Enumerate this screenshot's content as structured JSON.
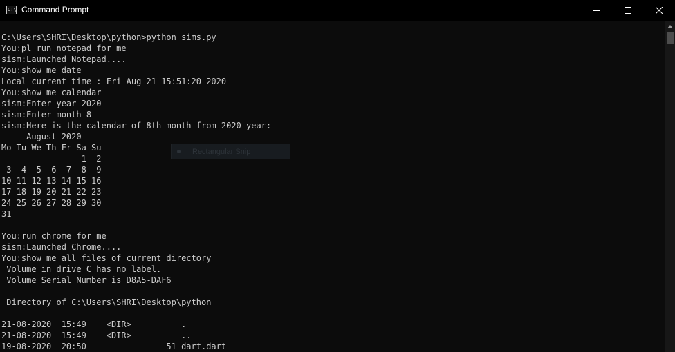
{
  "window": {
    "title": "Command Prompt",
    "icon": "command-prompt-icon",
    "icon_glyph": "C:\\.",
    "controls": [
      "minimize-icon",
      "maximize-icon",
      "close-icon"
    ]
  },
  "console": {
    "text_color": "#cccccc",
    "background": "#0c0c0c",
    "lines": [
      "C:\\Users\\SHRI\\Desktop\\python>python sims.py",
      "You:pl run notepad for me",
      "sism:Launched Notepad....",
      "You:show me date",
      "Local current time : Fri Aug 21 15:51:20 2020",
      "You:show me calendar",
      "sism:Enter year-2020",
      "sism:Enter month-8",
      "sism:Here is the calendar of 8th month from 2020 year:",
      "     August 2020",
      "Mo Tu We Th Fr Sa Su",
      "                1  2",
      " 3  4  5  6  7  8  9",
      "10 11 12 13 14 15 16",
      "17 18 19 20 21 22 23",
      "24 25 26 27 28 29 30",
      "31",
      "",
      "You:run chrome for me",
      "sism:Launched Chrome....",
      "You:show me all files of current directory",
      " Volume in drive C has no label.",
      " Volume Serial Number is D8A5-DAF6",
      "",
      " Directory of C:\\Users\\SHRI\\Desktop\\python",
      "",
      "21-08-2020  15:49    <DIR>          .",
      "21-08-2020  15:49    <DIR>          ..",
      "19-08-2020  20:50                51 dart.dart"
    ]
  },
  "overlay": {
    "label": "Rectangular Snip",
    "icon": "snip-mode-icon"
  },
  "scrollbar": {
    "up_icon": "scroll-up-arrow-icon"
  }
}
